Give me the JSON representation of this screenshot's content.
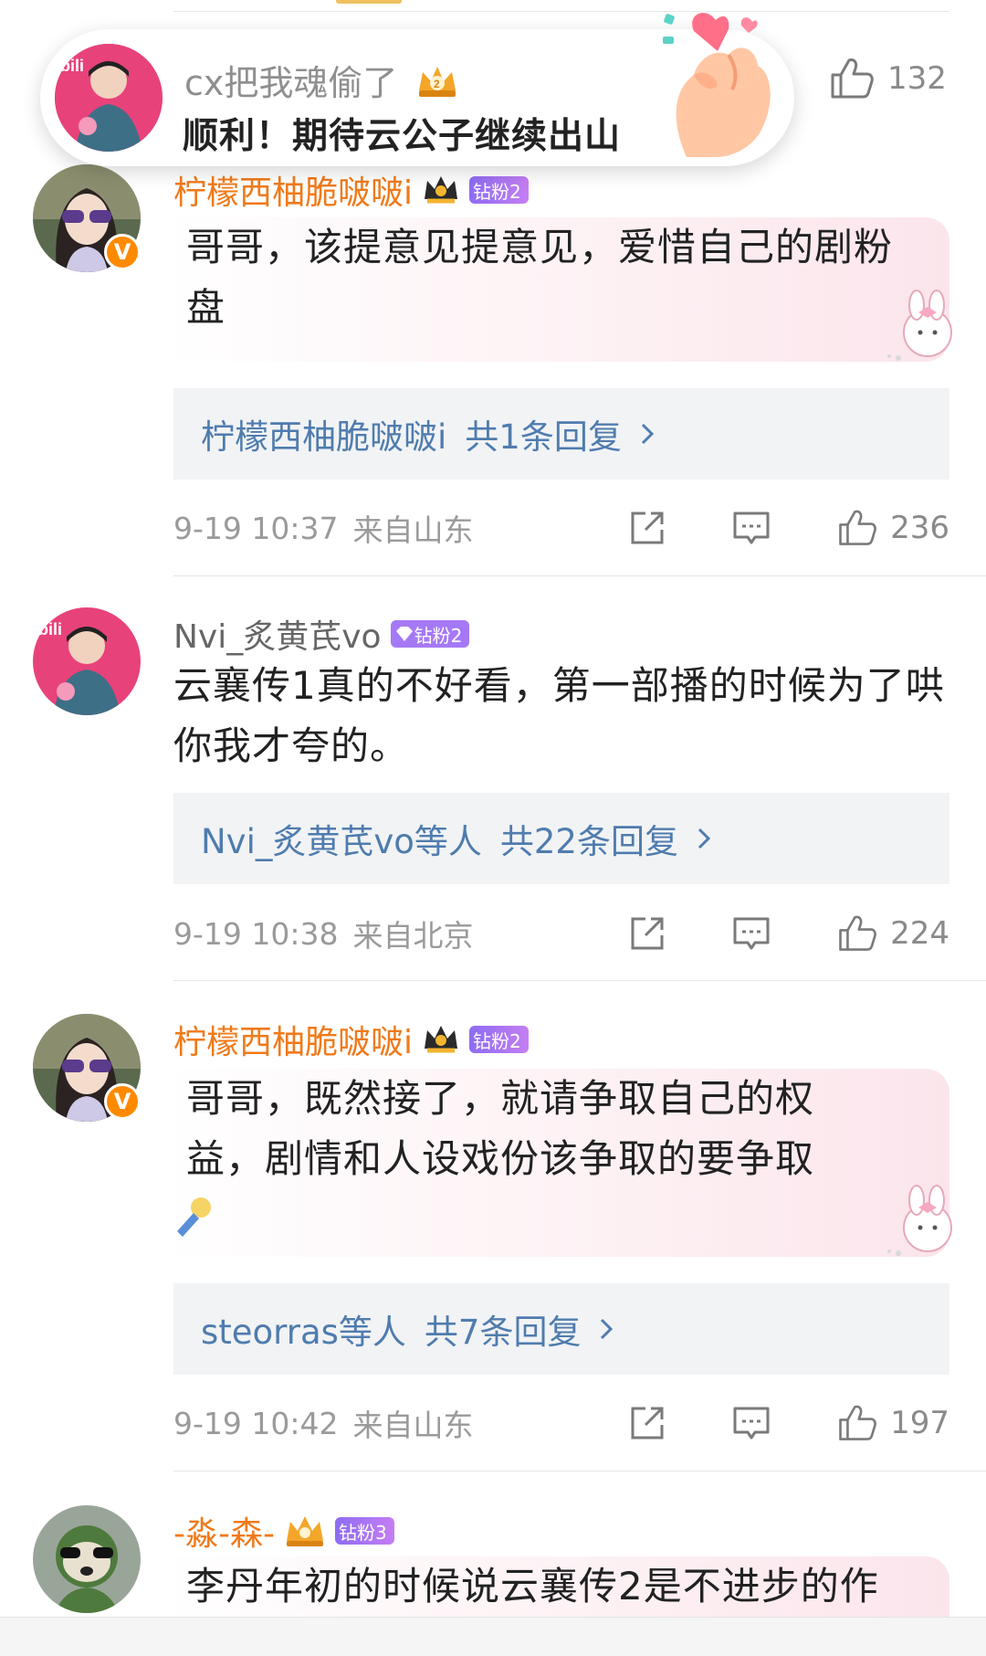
{
  "banner": {
    "username": "cx把我魂偷了",
    "text": "顺利！期待云公子继续出山",
    "like_count": "132"
  },
  "comments": [
    {
      "username": "柠檬西柚脆啵啵i",
      "badge": "钻粉2",
      "body": "哥哥，该提意见提意见，爱惜自己的剧粉盘",
      "reply_summary": "柠檬西柚脆啵啵i",
      "reply_count_text": "共1条回复",
      "time": "9-19 10:37",
      "location": "来自山东",
      "like_count": "236"
    },
    {
      "username": "Nvi_炙黄芪vo",
      "badge": "钻粉2",
      "body": "云襄传1真的不好看，第一部播的时候为了哄你我才夸的。",
      "reply_summary": "Nvi_炙黄芪vo等人",
      "reply_count_text": "共22条回复",
      "time": "9-19 10:38",
      "location": "来自北京",
      "like_count": "224"
    },
    {
      "username": "柠檬西柚脆啵啵i",
      "badge": "钻粉2",
      "body": "哥哥，既然接了，就请争取自己的权益，剧情和人设戏份该争取的要争取",
      "reply_summary": "steorras等人",
      "reply_count_text": "共7条回复",
      "time": "9-19 10:42",
      "location": "来自山东",
      "like_count": "197"
    },
    {
      "username": "-淼-森-",
      "badge": "钻粉3",
      "body": "李丹年初的时候说云襄传2是不进步的作"
    }
  ],
  "icons": {
    "share": "share-icon",
    "comment": "comment-icon",
    "like": "thumbs-up-icon",
    "chevron": "chevron-right-icon",
    "crown": "crown-icon",
    "verified": "verified-v-icon"
  },
  "colors": {
    "username_orange": "#f07a1a",
    "link_blue": "#4f7cae",
    "meta_gray": "#9a9a9a",
    "badge_purple": "#a579f5",
    "verified_orange": "#ff8a00"
  }
}
